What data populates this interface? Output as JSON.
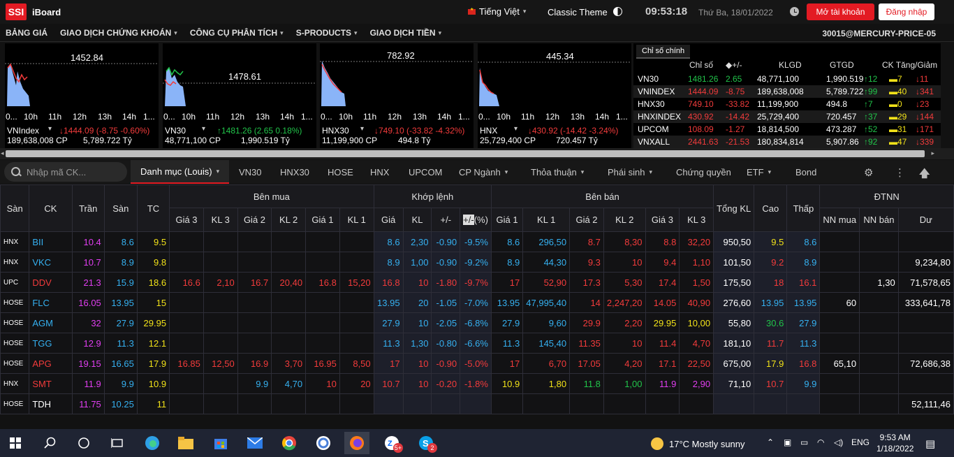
{
  "header": {
    "logo": "SSI",
    "app_name": "iBoard",
    "language": "Tiếng Việt",
    "theme": "Classic Theme",
    "clock": "09:53:18",
    "date": "Thứ Ba, 18/01/2022",
    "open_account": "Mở tài khoản",
    "register": "Đăng nhập"
  },
  "nav": {
    "items": [
      "BẢNG GIÁ",
      "GIAO DỊCH CHỨNG KHOÁN",
      "CÔNG CỤ PHÂN TÍCH",
      "S-PRODUCTS",
      "GIAO DỊCH TIỀN"
    ],
    "account": "30015@MERCURY-PRICE-05"
  },
  "mini_charts": [
    {
      "label": "1452.84",
      "name": "VNIndex",
      "change": "↓1444.09 (-8.75 -0.60%)",
      "change_color": "#f23b3b",
      "volume": "189,638,008 CP",
      "value": "5,789.722 Tỷ",
      "ticks": [
        "0...",
        "10h",
        "11h",
        "12h",
        "13h",
        "14h",
        "1..."
      ]
    },
    {
      "label": "1478.61",
      "name": "VN30",
      "change": "↑1481.26 (2.65 0.18%)",
      "change_color": "#21c44a",
      "volume": "48,771,100 CP",
      "value": "1,990.519 Tỷ",
      "ticks": [
        "0...",
        "10h",
        "11h",
        "12h",
        "13h",
        "14h",
        "1..."
      ]
    },
    {
      "label": "782.92",
      "name": "HNX30",
      "change": "↓749.10 (-33.82 -4.32%)",
      "change_color": "#f23b3b",
      "volume": "11,199,900 CP",
      "value": "494.8 Tỷ",
      "ticks": [
        "0...",
        "10h",
        "11h",
        "12h",
        "13h",
        "14h",
        "1..."
      ]
    },
    {
      "label": "445.34",
      "name": "HNX",
      "change": "↓430.92 (-14.42 -3.24%)",
      "change_color": "#f23b3b",
      "volume": "25,729,400 CP",
      "value": "720.457 Tỷ",
      "ticks": [
        "0...",
        "10h",
        "11h",
        "12h",
        "13h",
        "14h",
        "1..."
      ]
    }
  ],
  "index_table": {
    "tab": "Chỉ số chính",
    "headers": [
      "Chỉ số",
      "◆+/-",
      "KLGD",
      "GTGD",
      "CK Tăng/Giảm"
    ],
    "rows": [
      {
        "name": "VN30",
        "index": "1481.26",
        "index_color": "#21c44a",
        "chg": "2.65",
        "chg_color": "#21c44a",
        "vol": "48,771,100",
        "val": "1,990.519",
        "up": "↑12",
        "eq": "▬7",
        "down": "↓11"
      },
      {
        "name": "VNINDEX",
        "index": "1444.09",
        "index_color": "#f23b3b",
        "chg": "-8.75",
        "chg_color": "#f23b3b",
        "vol": "189,638,008",
        "val": "5,789.722",
        "up": "↑99",
        "eq": "▬40",
        "down": "↓341"
      },
      {
        "name": "HNX30",
        "index": "749.10",
        "index_color": "#f23b3b",
        "chg": "-33.82",
        "chg_color": "#f23b3b",
        "vol": "11,199,900",
        "val": "494.8",
        "up": "↑7",
        "eq": "▬0",
        "down": "↓23"
      },
      {
        "name": "HNXINDEX",
        "index": "430.92",
        "index_color": "#f23b3b",
        "chg": "-14.42",
        "chg_color": "#f23b3b",
        "vol": "25,729,400",
        "val": "720.457",
        "up": "↑37",
        "eq": "▬29",
        "down": "↓144"
      },
      {
        "name": "UPCOM",
        "index": "108.09",
        "index_color": "#f23b3b",
        "chg": "-1.27",
        "chg_color": "#f23b3b",
        "vol": "18,814,500",
        "val": "473.287",
        "up": "↑52",
        "eq": "▬31",
        "down": "↓171"
      },
      {
        "name": "VNXALL",
        "index": "2441.63",
        "index_color": "#f23b3b",
        "chg": "-21.53",
        "chg_color": "#f23b3b",
        "vol": "180,834,814",
        "val": "5,907.86",
        "up": "↑92",
        "eq": "▬47",
        "down": "↓339"
      }
    ]
  },
  "tabs": {
    "search_placeholder": "Nhập mã CK...",
    "active": "Danh mục (Louis)",
    "items": [
      "VN30",
      "HNX30",
      "HOSE",
      "HNX",
      "UPCOM",
      "CP Ngành",
      "Thỏa thuận",
      "Phái sinh",
      "Chứng quyền",
      "ETF",
      "Bond"
    ]
  },
  "board": {
    "groups": {
      "buy": "Bên mua",
      "match": "Khớp lệnh",
      "sell": "Bên bán",
      "foreign": "ĐTNN"
    },
    "cols": {
      "san": "Sàn",
      "ck": "CK",
      "tran": "Trần",
      "san_price": "Sàn",
      "tc": "TC",
      "gia3": "Giá 3",
      "kl3": "KL 3",
      "gia2": "Giá 2",
      "kl2": "KL 2",
      "gia1": "Giá 1",
      "kl1": "KL 1",
      "gia": "Giá",
      "kl": "KL",
      "pm": "+/-",
      "pct_hl": "+/-",
      "pct": "(%)",
      "total": "Tổng KL",
      "high": "Cao",
      "low": "Thấp",
      "nn_buy": "NN mua",
      "nn_sell": "NN bán",
      "du": "Dư"
    },
    "rows": [
      [
        "HNX",
        "BII",
        "10.4",
        "8.6",
        "9.5",
        "",
        "",
        "",
        "",
        "",
        "",
        "8.6",
        "2,30",
        "-0.90",
        "-9.5%",
        "8.6",
        "296,50",
        "8.7",
        "8,30",
        "8.8",
        "32,20",
        "950,50",
        "9.5",
        "8.6",
        "",
        "",
        ""
      ],
      [
        "HNX",
        "VKC",
        "10.7",
        "8.9",
        "9.8",
        "",
        "",
        "",
        "",
        "",
        "",
        "8.9",
        "1,00",
        "-0.90",
        "-9.2%",
        "8.9",
        "44,30",
        "9.3",
        "10",
        "9.4",
        "1,10",
        "101,50",
        "9.2",
        "8.9",
        "",
        "",
        "9,234,80"
      ],
      [
        "UPC",
        "DDV",
        "21.3",
        "15.9",
        "18.6",
        "16.6",
        "2,10",
        "16.7",
        "20,40",
        "16.8",
        "15,20",
        "16.8",
        "10",
        "-1.80",
        "-9.7%",
        "17",
        "52,90",
        "17.3",
        "5,30",
        "17.4",
        "1,50",
        "175,50",
        "18",
        "16.1",
        "",
        "1,30",
        "71,578,65"
      ],
      [
        "HOSE",
        "FLC",
        "16.05",
        "13.95",
        "15",
        "",
        "",
        "",
        "",
        "",
        "",
        "13.95",
        "20",
        "-1.05",
        "-7.0%",
        "13.95",
        "47,995,40",
        "14",
        "2,247,20",
        "14.05",
        "40,90",
        "276,60",
        "13.95",
        "13.95",
        "60",
        "",
        "333,641,78"
      ],
      [
        "HOSE",
        "AGM",
        "32",
        "27.9",
        "29.95",
        "",
        "",
        "",
        "",
        "",
        "",
        "27.9",
        "10",
        "-2.05",
        "-6.8%",
        "27.9",
        "9,60",
        "29.9",
        "2,20",
        "29.95",
        "10,00",
        "55,80",
        "30.6",
        "27.9",
        "",
        "",
        ""
      ],
      [
        "HOSE",
        "TGG",
        "12.9",
        "11.3",
        "12.1",
        "",
        "",
        "",
        "",
        "",
        "",
        "11.3",
        "1,30",
        "-0.80",
        "-6.6%",
        "11.3",
        "145,40",
        "11.35",
        "10",
        "11.4",
        "4,70",
        "181,10",
        "11.7",
        "11.3",
        "",
        "",
        ""
      ],
      [
        "HOSE",
        "APG",
        "19.15",
        "16.65",
        "17.9",
        "16.85",
        "12,50",
        "16.9",
        "3,70",
        "16.95",
        "8,50",
        "17",
        "10",
        "-0.90",
        "-5.0%",
        "17",
        "6,70",
        "17.05",
        "4,20",
        "17.1",
        "22,50",
        "675,00",
        "17.9",
        "16.8",
        "65,10",
        "",
        "72,686,38"
      ],
      [
        "HNX",
        "SMT",
        "11.9",
        "9.9",
        "10.9",
        "",
        "",
        "9.9",
        "4,70",
        "10",
        "20",
        "10.7",
        "10",
        "-0.20",
        "-1.8%",
        "10.9",
        "1,80",
        "11.8",
        "1,00",
        "11.9",
        "2,90",
        "71,10",
        "10.7",
        "9.9",
        "",
        "",
        ""
      ],
      [
        "HOSE",
        "TDH",
        "11.75",
        "10.25",
        "11",
        "",
        "",
        "",
        "",
        "",
        "",
        "",
        "",
        "",
        "",
        "",
        "",
        "",
        "",
        "",
        "",
        "",
        "",
        "",
        "",
        "",
        "52,111,46"
      ]
    ],
    "colors": [
      [
        "white",
        "blue",
        "purple",
        "blue",
        "yellow",
        "red",
        "red",
        "red",
        "red",
        "red",
        "red",
        "blue",
        "blue",
        "blue",
        "blue",
        "blue",
        "blue",
        "red",
        "red",
        "red",
        "red",
        "white",
        "yellow",
        "blue",
        "white",
        "white",
        "white"
      ],
      [
        "white",
        "blue",
        "purple",
        "blue",
        "yellow",
        "red",
        "red",
        "red",
        "red",
        "red",
        "red",
        "blue",
        "blue",
        "blue",
        "blue",
        "blue",
        "blue",
        "red",
        "red",
        "red",
        "red",
        "white",
        "red",
        "blue",
        "white",
        "white",
        "white"
      ],
      [
        "white",
        "red",
        "purple",
        "blue",
        "yellow",
        "red",
        "red",
        "red",
        "red",
        "red",
        "red",
        "red",
        "red",
        "red",
        "red",
        "red",
        "red",
        "red",
        "red",
        "red",
        "red",
        "white",
        "red",
        "red",
        "white",
        "white",
        "white"
      ],
      [
        "white",
        "blue",
        "purple",
        "blue",
        "yellow",
        "red",
        "red",
        "red",
        "red",
        "red",
        "red",
        "blue",
        "blue",
        "blue",
        "blue",
        "blue",
        "blue",
        "red",
        "red",
        "red",
        "red",
        "white",
        "blue",
        "blue",
        "white",
        "white",
        "white"
      ],
      [
        "white",
        "blue",
        "purple",
        "blue",
        "yellow",
        "red",
        "red",
        "red",
        "red",
        "red",
        "red",
        "blue",
        "blue",
        "blue",
        "blue",
        "blue",
        "blue",
        "red",
        "red",
        "yellow",
        "yellow",
        "white",
        "green",
        "blue",
        "white",
        "white",
        "white"
      ],
      [
        "white",
        "blue",
        "purple",
        "blue",
        "yellow",
        "red",
        "red",
        "red",
        "red",
        "red",
        "red",
        "blue",
        "blue",
        "blue",
        "blue",
        "blue",
        "blue",
        "red",
        "red",
        "red",
        "red",
        "white",
        "red",
        "blue",
        "white",
        "white",
        "white"
      ],
      [
        "white",
        "red",
        "purple",
        "blue",
        "yellow",
        "red",
        "red",
        "red",
        "red",
        "red",
        "red",
        "red",
        "red",
        "red",
        "red",
        "red",
        "red",
        "red",
        "red",
        "red",
        "red",
        "white",
        "yellow",
        "red",
        "white",
        "white",
        "white"
      ],
      [
        "white",
        "red",
        "purple",
        "blue",
        "yellow",
        "red",
        "red",
        "blue",
        "blue",
        "red",
        "red",
        "red",
        "red",
        "red",
        "red",
        "yellow",
        "yellow",
        "green",
        "green",
        "purple",
        "purple",
        "white",
        "red",
        "blue",
        "white",
        "white",
        "white"
      ],
      [
        "white",
        "white",
        "purple",
        "blue",
        "yellow",
        "white",
        "white",
        "white",
        "white",
        "white",
        "white",
        "white",
        "white",
        "white",
        "white",
        "white",
        "white",
        "white",
        "white",
        "white",
        "white",
        "white",
        "white",
        "white",
        "white",
        "white",
        "white"
      ]
    ]
  },
  "taskbar": {
    "weather": "17°C  Mostly sunny",
    "lang": "ENG",
    "time": "9:53 AM",
    "date": "1/18/2022",
    "badges": [
      "5+",
      "2"
    ]
  }
}
